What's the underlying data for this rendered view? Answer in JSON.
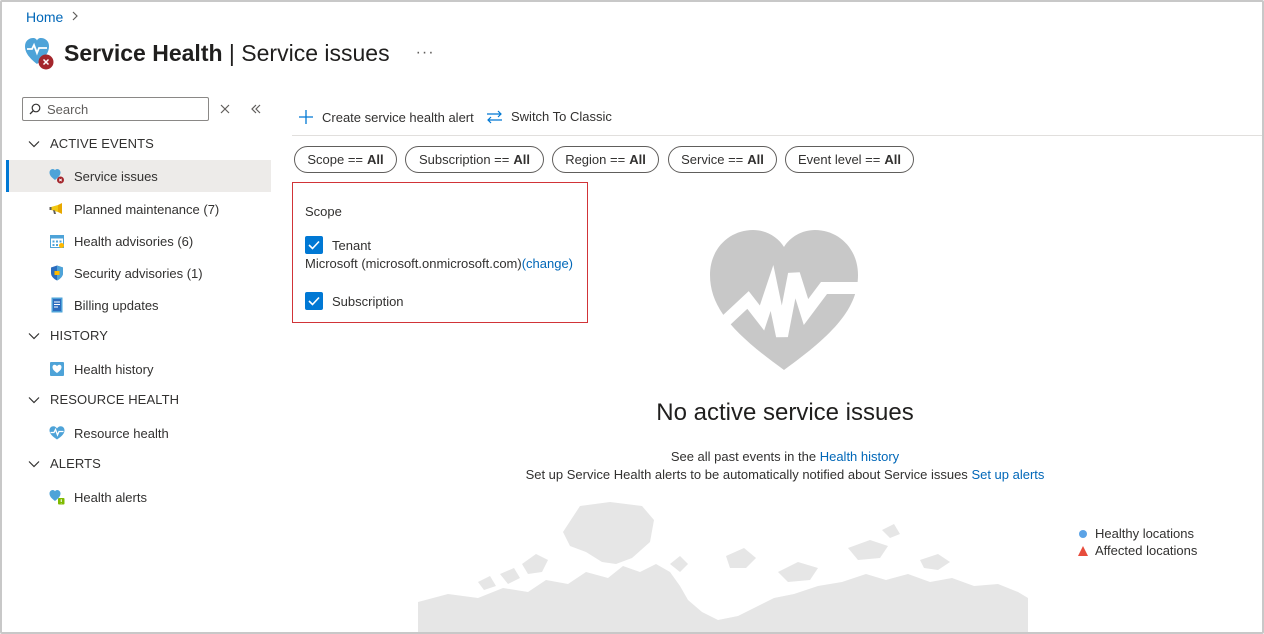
{
  "breadcrumb": {
    "home": "Home"
  },
  "header": {
    "service": "Service Health",
    "separator": "|",
    "page": "Service issues",
    "more": "···"
  },
  "sidebar": {
    "search_placeholder": "Search",
    "groups": [
      {
        "label": "ACTIVE EVENTS"
      },
      {
        "label": "HISTORY"
      },
      {
        "label": "RESOURCE HEALTH"
      },
      {
        "label": "ALERTS"
      }
    ],
    "items": [
      {
        "label": "Service issues",
        "icon": "service-issues-icon"
      },
      {
        "label": "Planned maintenance (7)",
        "icon": "megaphone-icon"
      },
      {
        "label": "Health advisories (6)",
        "icon": "calendar-icon"
      },
      {
        "label": "Security advisories (1)",
        "icon": "shield-icon"
      },
      {
        "label": "Billing updates",
        "icon": "document-icon"
      },
      {
        "label": "Health history",
        "icon": "health-history-icon"
      },
      {
        "label": "Resource health",
        "icon": "heartbeat-icon"
      },
      {
        "label": "Health alerts",
        "icon": "health-alerts-icon"
      }
    ]
  },
  "toolbar": {
    "create_alert": "Create service health alert",
    "switch_classic": "Switch To Classic"
  },
  "filters": [
    {
      "label": "Scope ==",
      "value": "All"
    },
    {
      "label": "Subscription ==",
      "value": "All"
    },
    {
      "label": "Region ==",
      "value": "All"
    },
    {
      "label": "Service ==",
      "value": "All"
    },
    {
      "label": "Event level ==",
      "value": "All"
    }
  ],
  "scope_panel": {
    "title": "Scope",
    "tenant_label": "Tenant",
    "tenant_name": "Microsoft (microsoft.onmicrosoft.com)",
    "change_link": "(change)",
    "subscription_label": "Subscription"
  },
  "empty_state": {
    "title": "No active service issues",
    "history_text": "See all past events in the",
    "history_link": "Health history",
    "alerts_text": "Set up Service Health alerts to be automatically notified about Service issues",
    "alerts_link": "Set up alerts"
  },
  "legend": {
    "healthy": "Healthy locations",
    "affected": "Affected locations"
  },
  "colors": {
    "accent": "#0078d4",
    "link": "#0067b8",
    "error": "#d13438",
    "healthy": "#5ba3e6",
    "affected": "#e74c3c"
  }
}
